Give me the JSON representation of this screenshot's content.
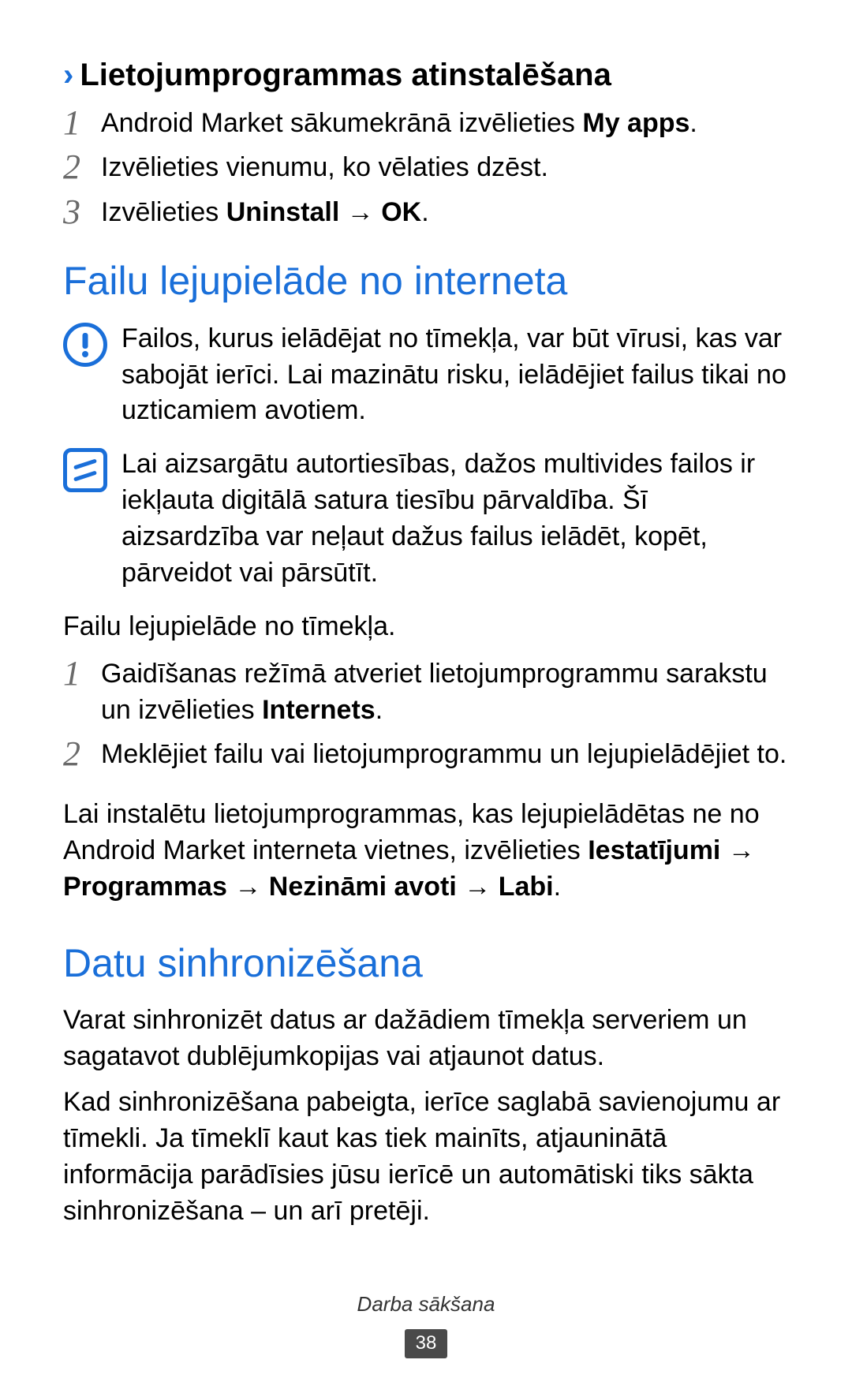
{
  "section1": {
    "heading": "Lietojumprogrammas atinstalēšana",
    "steps": [
      {
        "num": "1",
        "text_before": "Android Market sākumekrānā izvēlieties ",
        "bold": "My apps",
        "text_after": "."
      },
      {
        "num": "2",
        "text_before": "Izvēlieties vienumu, ko vēlaties dzēst.",
        "bold": "",
        "text_after": ""
      },
      {
        "num": "3",
        "text_before": "Izvēlieties ",
        "bold": "Uninstall → OK",
        "text_after": "."
      }
    ]
  },
  "section2": {
    "heading": "Failu lejupielāde no interneta",
    "warn": "Failos, kurus ielādējat no tīmekļa, var būt vīrusi, kas var sabojāt ierīci. Lai mazinātu risku, ielādējiet failus tikai no uzticamiem avotiem.",
    "note": "Lai aizsargātu autortiesības, dažos multivides failos ir iekļauta digitālā satura tiesību pārvaldība. Šī aizsardzība var neļaut dažus failus ielādēt, kopēt, pārveidot vai pārsūtīt.",
    "intro": "Failu lejupielāde no tīmekļa.",
    "steps": [
      {
        "num": "1",
        "text_before": "Gaidīšanas režīmā atveriet lietojumprogrammu sarakstu un izvēlieties ",
        "bold": "Internets",
        "text_after": "."
      },
      {
        "num": "2",
        "text_before": "Meklējiet failu vai lietojumprogrammu un lejupielādējiet to.",
        "bold": "",
        "text_after": ""
      }
    ],
    "after_before": "Lai instalētu lietojumprogrammas, kas lejupielādētas ne no Android Market interneta vietnes, izvēlieties ",
    "after_bold": "Iestatījumi → Programmas → Nezināmi avoti → Labi",
    "after_after": "."
  },
  "section3": {
    "heading": "Datu sinhronizēšana",
    "para1": "Varat sinhronizēt datus ar dažādiem tīmekļa serveriem un sagatavot dublējumkopijas vai atjaunot datus.",
    "para2": "Kad sinhronizēšana pabeigta, ierīce saglabā savienojumu ar tīmekli. Ja tīmeklī kaut kas tiek mainīts, atjauninātā informācija parādīsies jūsu ierīcē un automātiski tiks sākta sinhronizēšana – un arī pretēji."
  },
  "footer": {
    "title": "Darba sākšana",
    "page": "38"
  }
}
